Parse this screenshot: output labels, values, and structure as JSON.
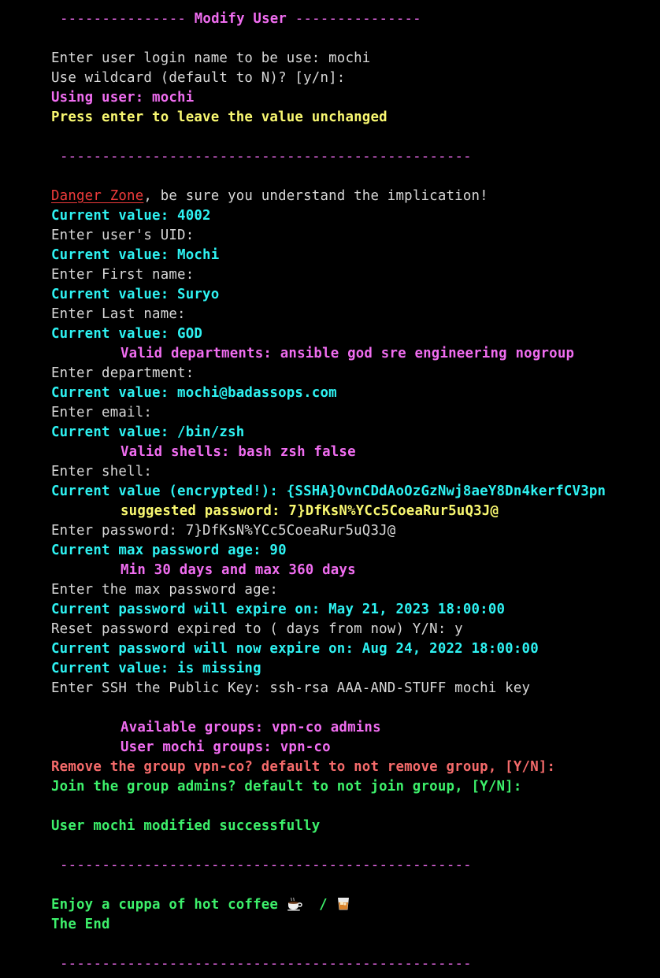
{
  "header": {
    "dashes_left": "---------------",
    "title": "Modify User",
    "dashes_right": "---------------"
  },
  "separator": "-------------------------------------------------",
  "login": {
    "prompt": "Enter user login name to be use: mochi",
    "wildcard": "Use wildcard (default to N)? [y/n]:",
    "using": "Using user: mochi",
    "press_enter": "Press enter to leave the value unchanged"
  },
  "danger": {
    "zone": "Danger Zone",
    "rest": ", be sure you understand the implication!"
  },
  "uid": {
    "current": "Current value: 4002",
    "prompt": "Enter user's UID:"
  },
  "first_name": {
    "current": "Current value: Mochi",
    "prompt": "Enter First name:"
  },
  "last_name": {
    "current": "Current value: Suryo",
    "prompt": "Enter Last name:"
  },
  "department": {
    "current": "Current value: GOD",
    "valid": "Valid departments: ansible god sre engineering nogroup",
    "prompt": "Enter department:"
  },
  "email": {
    "current": "Current value: mochi@badassops.com",
    "prompt": "Enter email:"
  },
  "shell": {
    "current": "Current value: /bin/zsh",
    "valid": "Valid shells: bash zsh false",
    "prompt": "Enter shell:"
  },
  "password": {
    "current": "Current value (encrypted!): {SSHA}OvnCDdAoOzGzNwj8aeY8Dn4kerfCV3pn",
    "suggested": "suggested password: 7}DfKsN%YCc5CoeaRur5uQ3J@",
    "prompt": "Enter password: 7}DfKsN%YCc5CoeaRur5uQ3J@"
  },
  "max_age": {
    "current": "Current max password age: 90",
    "range": "Min 30 days and max 360 days",
    "prompt": "Enter the max password age:"
  },
  "expire": {
    "current": "Current password will expire on: May 21, 2023 18:00:00",
    "reset": "Reset password expired to ( days from now) Y/N: y",
    "now": "Current password will now expire on: Aug 24, 2022 18:00:00"
  },
  "ssh": {
    "current": "Current value: is missing",
    "prompt": "Enter SSH the Public Key: ssh-rsa AAA-AND-STUFF mochi key"
  },
  "groups": {
    "available": "Available groups: vpn-co admins",
    "user_groups": "User mochi groups: vpn-co",
    "remove": "Remove the group vpn-co? default to not remove group, [Y/N]:",
    "join": "Join the group admins? default to not join group, [Y/N]:"
  },
  "result": "User mochi modified successfully",
  "ending": {
    "coffee": "Enjoy a cuppa of hot coffee",
    "slash": "/",
    "the_end": "The End",
    "icons": [
      "hot-beverage-icon",
      "tumbler-glass-icon"
    ]
  },
  "colors": {
    "background": "#000000",
    "default_text": "#d8d8d8",
    "cyan": "#2ef2f2",
    "magenta": "#f06df0",
    "yellow": "#f9f871",
    "red": "#f56b6b",
    "green": "#3df06b",
    "danger_red": "#ef3b3b"
  }
}
